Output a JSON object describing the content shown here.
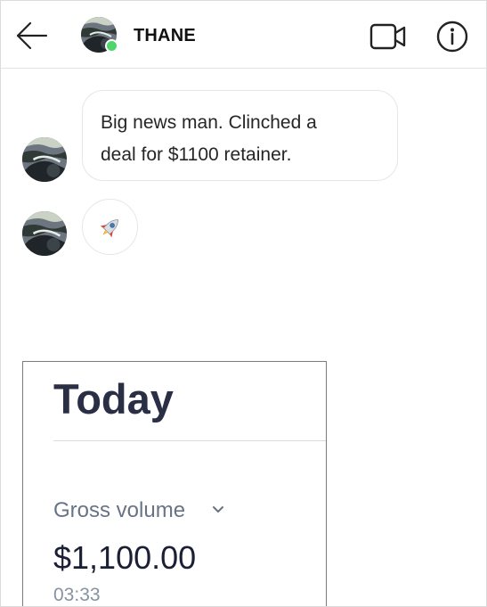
{
  "header": {
    "back_icon": "arrow-left-icon",
    "contact_name": "THANE",
    "online_status_color": "#4fd66a",
    "video_icon": "video-camera-icon",
    "info_icon": "info-circle-icon"
  },
  "messages": [
    {
      "type": "text",
      "text_line1": "Big news man. Clinched a",
      "text_line2": "deal for $1100 retainer."
    },
    {
      "type": "emoji",
      "emoji_icon": "rocket-icon"
    },
    {
      "type": "image",
      "image": {
        "title": "Today",
        "metric_label": "Gross volume",
        "metric_dropdown_icon": "chevron-down-icon",
        "amount": "$1,100.00",
        "time": "03:33"
      }
    }
  ],
  "colors": {
    "title_text": "#2a2f45",
    "metric_label": "#697386",
    "amount_text": "#1a1f36",
    "time_text": "#8792a2"
  }
}
